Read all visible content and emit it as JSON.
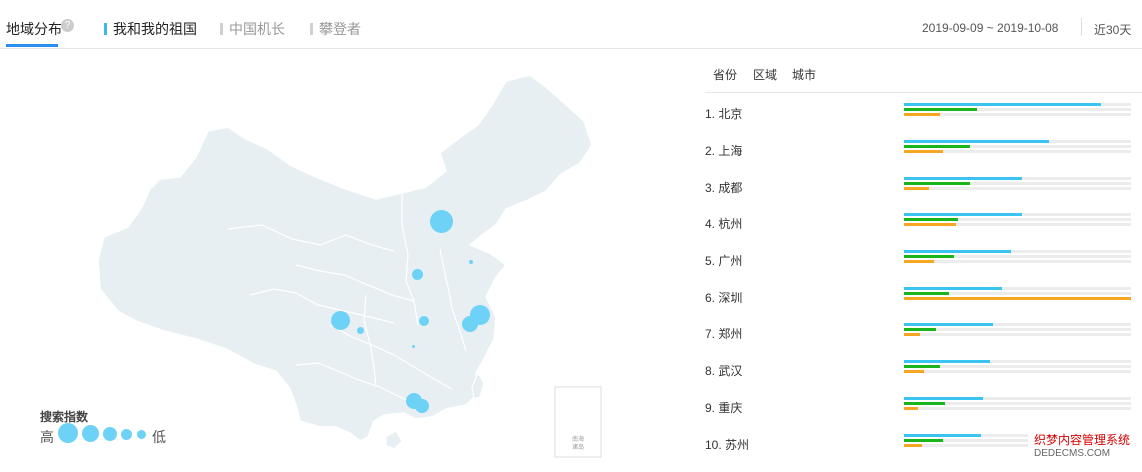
{
  "header": {
    "title": "地域分布",
    "help_icon": "?",
    "legend": [
      {
        "label": "我和我的祖国",
        "color": "#3bb9e8"
      },
      {
        "label": "中国机长",
        "color": "#cfcfcf"
      },
      {
        "label": "攀登者",
        "color": "#cfcfcf"
      }
    ],
    "date_range": "2019-09-09 ~ 2019-10-08",
    "period": "近30天"
  },
  "map": {
    "legend_title": "搜索指数",
    "legend_high": "高",
    "legend_low": "低",
    "islands_label_1": "南海",
    "islands_label_2": "诸岛"
  },
  "tabs": [
    "省份",
    "区域",
    "城市"
  ],
  "ranking": [
    {
      "label": "1.   北京",
      "values": [
        0.87,
        0.32,
        0.16
      ]
    },
    {
      "label": "2.   上海",
      "values": [
        0.64,
        0.29,
        0.17
      ]
    },
    {
      "label": "3.   成都",
      "values": [
        0.52,
        0.29,
        0.11
      ]
    },
    {
      "label": "4.   杭州",
      "values": [
        0.52,
        0.24,
        0.23
      ]
    },
    {
      "label": "5.   广州",
      "values": [
        0.47,
        0.22,
        0.13
      ]
    },
    {
      "label": "6.   深圳",
      "values": [
        0.43,
        0.2,
        1.0
      ]
    },
    {
      "label": "7.   郑州",
      "values": [
        0.39,
        0.14,
        0.07
      ]
    },
    {
      "label": "8.   武汉",
      "values": [
        0.38,
        0.16,
        0.09
      ]
    },
    {
      "label": "9.   重庆",
      "values": [
        0.35,
        0.18,
        0.06
      ]
    },
    {
      "label": "10. 苏州",
      "values": [
        0.34,
        0.17,
        0.08
      ]
    }
  ],
  "colors": {
    "series1": "#3bc4f2",
    "series2": "#1ab51a",
    "series3": "#f5a623"
  },
  "watermark": {
    "line1": "织梦内容管理系统",
    "line2": "DEDECMS.COM"
  }
}
